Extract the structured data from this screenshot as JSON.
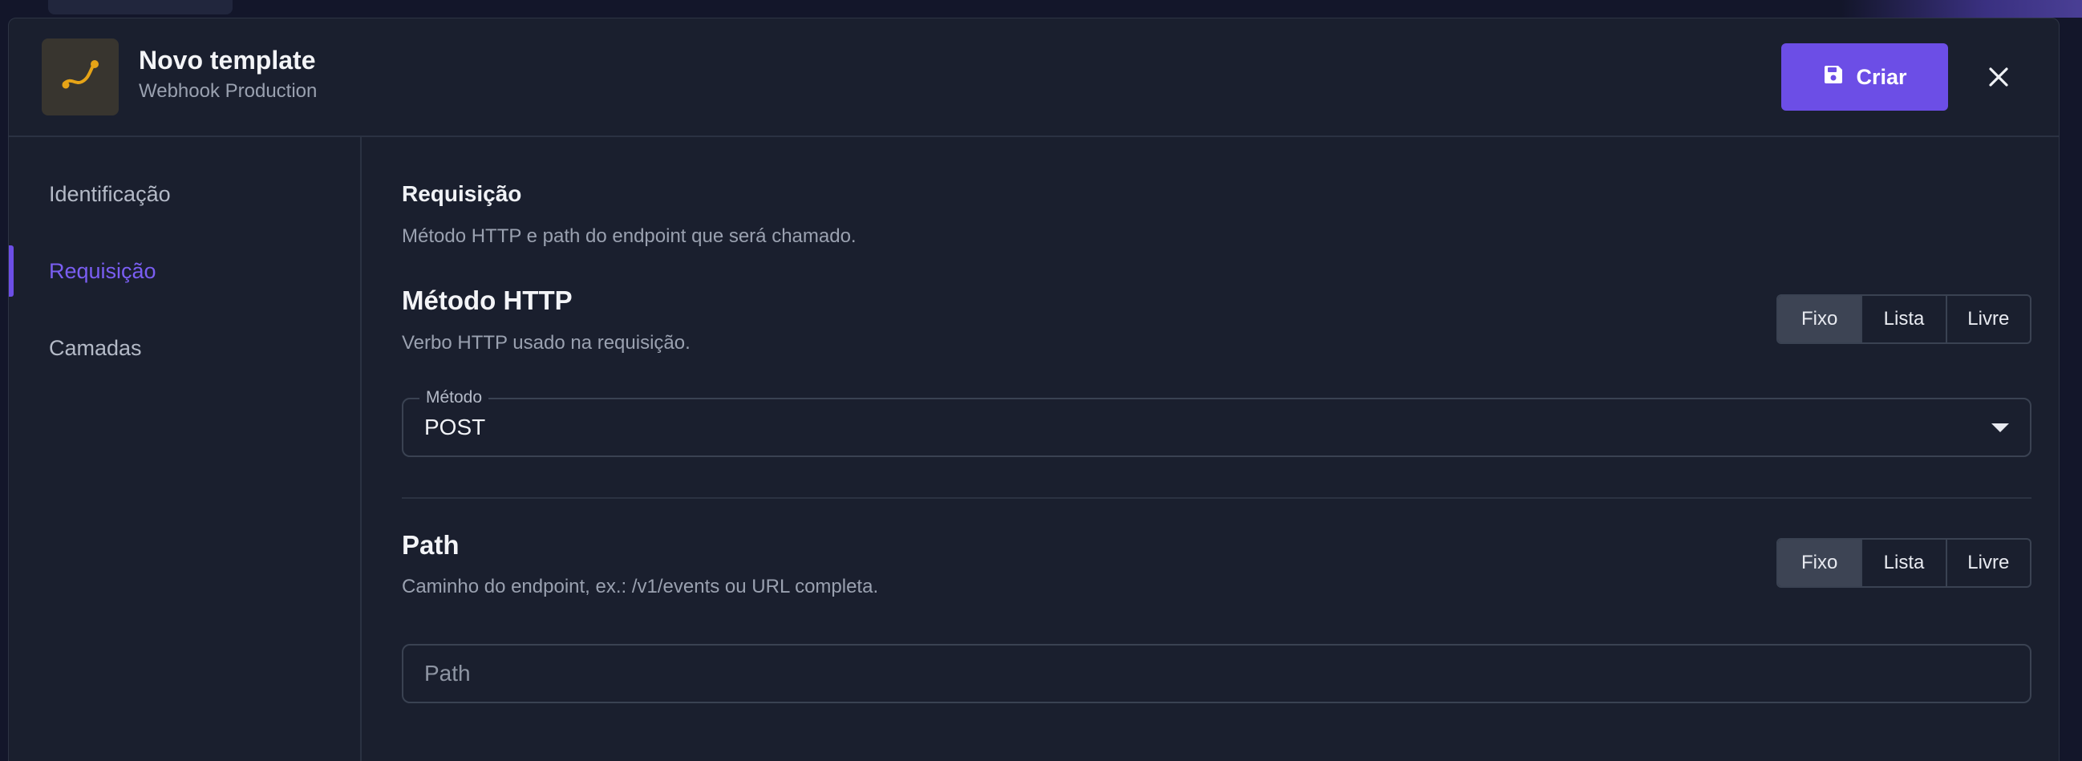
{
  "header": {
    "title": "Novo template",
    "subtitle": "Webhook Production",
    "icon": "route-icon",
    "create_label": "Criar",
    "create_icon": "save-icon",
    "close_icon": "close-icon"
  },
  "colors": {
    "accent": "#6c4ee6",
    "icon_accent": "#e6a417",
    "panel": "#1a1f2e"
  },
  "sidebar": {
    "items": [
      {
        "label": "Identificação",
        "active": false
      },
      {
        "label": "Requisição",
        "active": true
      },
      {
        "label": "Camadas",
        "active": false
      }
    ]
  },
  "main": {
    "section_title": "Requisição",
    "section_desc": "Método HTTP e path do endpoint que será chamado.",
    "method": {
      "title": "Método HTTP",
      "desc": "Verbo HTTP usado na requisição.",
      "modes": [
        "Fixo",
        "Lista",
        "Livre"
      ],
      "selected_mode": "Fixo",
      "field_label": "Método",
      "value": "POST"
    },
    "path": {
      "title": "Path",
      "desc": "Caminho do endpoint, ex.: /v1/events ou URL completa.",
      "modes": [
        "Fixo",
        "Lista",
        "Livre"
      ],
      "selected_mode": "Fixo",
      "placeholder": "Path",
      "value": ""
    }
  }
}
